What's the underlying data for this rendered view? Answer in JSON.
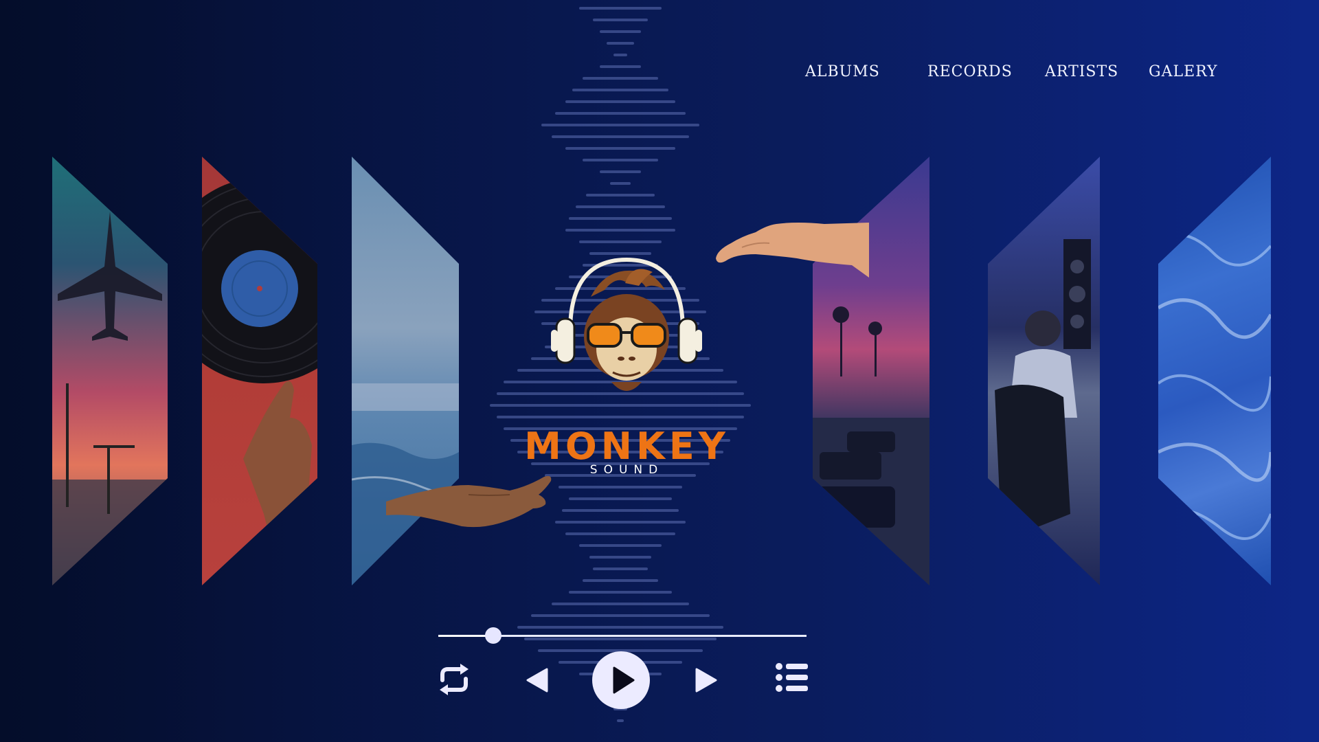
{
  "nav": {
    "items": [
      {
        "label": "ALBUMS"
      },
      {
        "label": "RECORDS"
      },
      {
        "label": "ARTISTS"
      },
      {
        "label": "GALERY"
      }
    ]
  },
  "brand": {
    "title": "MONKEY",
    "subtitle": "SOUND",
    "logo_icon": "monkey-headphones-logo",
    "title_color": "#ee7415"
  },
  "gallery": {
    "panels": [
      {
        "icon": "airplane-landing-image"
      },
      {
        "icon": "vinyl-record-hand-image"
      },
      {
        "icon": "ocean-beach-image"
      },
      {
        "icon": "palm-street-sunset-image"
      },
      {
        "icon": "recording-studio-image"
      },
      {
        "icon": "ocean-waves-image"
      }
    ]
  },
  "player": {
    "progress": 0.15,
    "controls": {
      "repeat_icon": "repeat-icon",
      "prev_icon": "previous-icon",
      "play_icon": "play-icon",
      "next_icon": "next-icon",
      "playlist_icon": "playlist-icon"
    }
  },
  "colors": {
    "background_dark": "#040d2a",
    "background_light": "#0d2687",
    "accent": "#ee7415",
    "control": "#ecebff"
  }
}
